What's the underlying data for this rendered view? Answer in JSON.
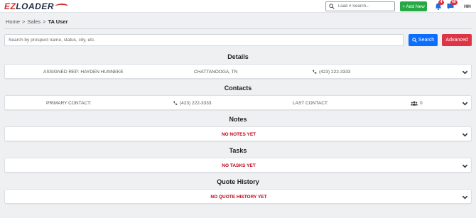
{
  "logo": {
    "part1": "EZ",
    "part2": "LOADER"
  },
  "topbar": {
    "load_search_placeholder": "Load # Search...",
    "add_new_label": "+ Add New",
    "notifications_count": "4",
    "messages_count": "40",
    "user_initials": "HH"
  },
  "breadcrumb": {
    "home": "Home",
    "sep": ">",
    "sales": "Sales",
    "current": "TA User"
  },
  "search": {
    "placeholder": "Search by prospect name, status, city, etc.",
    "search_label": "Search",
    "advanced_label": "Advanced"
  },
  "details": {
    "title": "Details",
    "assigned_rep": "ASSIGNED REP: HAYDEN HUNNEKE",
    "location": "CHATTANOOGA, TN",
    "phone": "(423) 222-3333"
  },
  "contacts": {
    "title": "Contacts",
    "primary_contact": "PRIMARY CONTACT:",
    "phone": "(423) 222-3333",
    "last_contact": "LAST CONTACT:",
    "count": "0"
  },
  "notes": {
    "title": "Notes",
    "empty": "NO NOTES YET"
  },
  "tasks": {
    "title": "Tasks",
    "empty": "NO TASKS YET"
  },
  "quote_history": {
    "title": "Quote History",
    "empty": "NO QUOTE HISTORY YET"
  },
  "colors": {
    "brand_red": "#d32f2f",
    "search_blue": "#0d6efd",
    "add_green": "#28a745",
    "advanced_red": "#dc3545",
    "empty_text": "#c0001a"
  },
  "icons": [
    "search-icon",
    "bell-icon",
    "message-icon",
    "phone-icon",
    "users-icon",
    "chevron-down-icon"
  ]
}
